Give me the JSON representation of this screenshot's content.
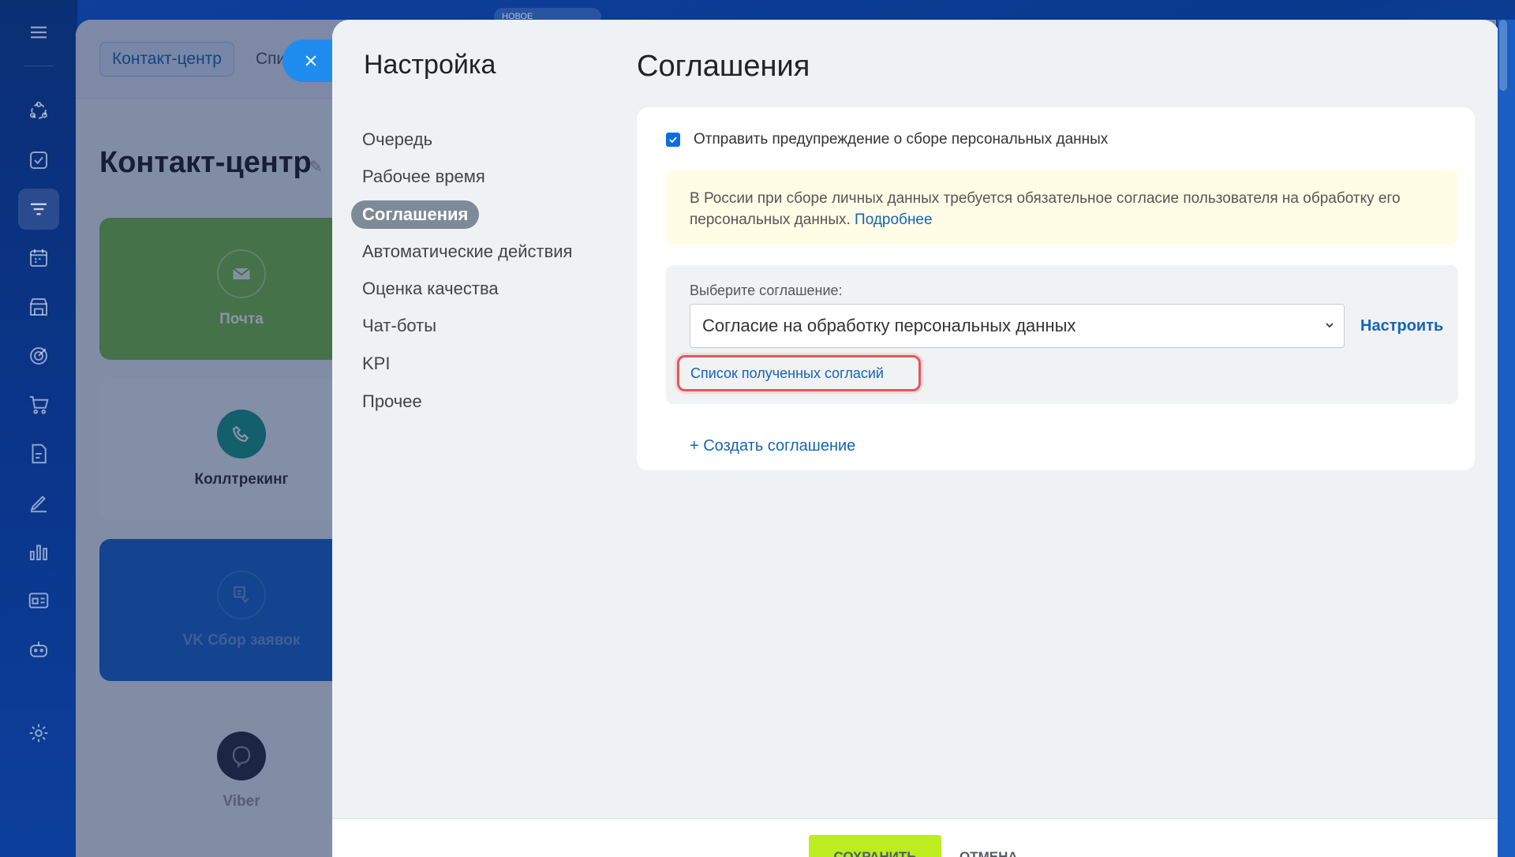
{
  "background": {
    "new_badge": "НОВОЕ",
    "breadcrumb": "Контакт-центр",
    "tab2": "Спи",
    "title": "Контакт-центр",
    "cards": [
      {
        "label": "Почта",
        "icon": "mail-icon"
      },
      {
        "label": "Коллтрекинг",
        "icon": "phone-arrows-icon"
      },
      {
        "label": "VK Сбор заявок",
        "icon": "vk-form-icon"
      },
      {
        "label": "Viber",
        "icon": "viber-icon"
      }
    ]
  },
  "sidebar_nav": {
    "title": "Настройка",
    "items": [
      {
        "label": "Очередь",
        "active": false
      },
      {
        "label": "Рабочее время",
        "active": false
      },
      {
        "label": "Соглашения",
        "active": true
      },
      {
        "label": "Автоматические действия",
        "active": false
      },
      {
        "label": "Оценка качества",
        "active": false
      },
      {
        "label": "Чат-боты",
        "active": false
      },
      {
        "label": "KPI",
        "active": false
      },
      {
        "label": "Прочее",
        "active": false
      }
    ]
  },
  "content": {
    "title": "Соглашения",
    "checkbox": {
      "label": "Отправить предупреждение о сборе персональных данных",
      "checked": true
    },
    "notice": {
      "text": "В России при сборе личных данных требуется обязательное согласие пользователя на обработку его персональных данных.",
      "link": "Подробнее"
    },
    "agreement": {
      "label": "Выберите соглашение:",
      "selected": "Согласие на обработку персональных данных",
      "configure": "Настроить",
      "consent_list": "Список полученных согласий"
    },
    "create_link": "+ Создать соглашение"
  },
  "footer": {
    "save": "СОХРАНИТЬ",
    "cancel": "ОТМЕНА"
  },
  "colors": {
    "accent": "#1464b4",
    "save": "#bbed21",
    "highlight": "#e2575b",
    "active_nav": "#7f8a97"
  }
}
